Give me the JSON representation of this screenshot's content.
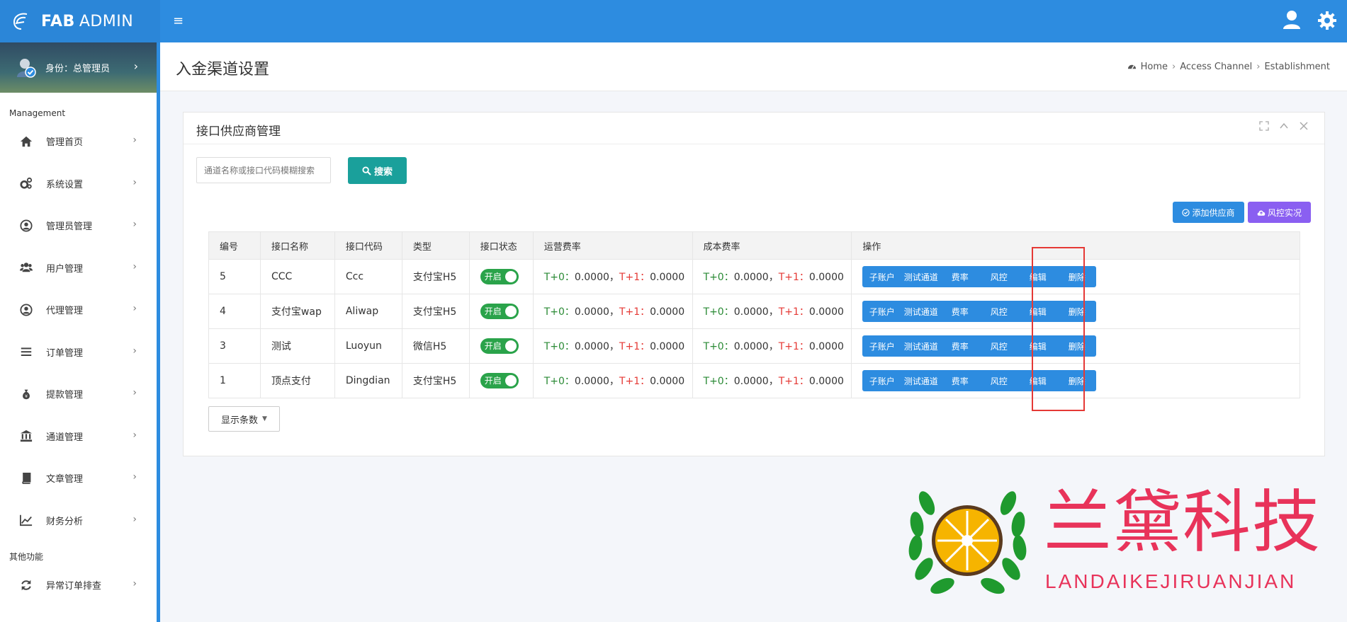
{
  "brand": {
    "bold": "FAB",
    "rest": "ADMIN"
  },
  "identity": {
    "label": "身份：总管理员"
  },
  "sidebar": {
    "section_management": "Management",
    "items": [
      {
        "label": "管理首页",
        "icon": "home-icon"
      },
      {
        "label": "系统设置",
        "icon": "gears-icon"
      },
      {
        "label": "管理员管理",
        "icon": "user-circle-icon"
      },
      {
        "label": "用户管理",
        "icon": "users-icon"
      },
      {
        "label": "代理管理",
        "icon": "user-circle-icon"
      },
      {
        "label": "订单管理",
        "icon": "list-icon"
      },
      {
        "label": "提款管理",
        "icon": "money-bag-icon"
      },
      {
        "label": "通道管理",
        "icon": "bank-icon"
      },
      {
        "label": "文章管理",
        "icon": "book-icon"
      },
      {
        "label": "财务分析",
        "icon": "chart-line-icon"
      }
    ],
    "section_other": "其他功能",
    "other_items": [
      {
        "label": "异常订单排查",
        "icon": "refresh-icon"
      }
    ]
  },
  "page": {
    "title": "入金渠道设置",
    "breadcrumb": [
      "Home",
      "Access Channel",
      "Establishment"
    ]
  },
  "panel": {
    "title": "接口供应商管理",
    "search_placeholder": "通道名称或接口代码模糊搜索",
    "search_button": "搜索",
    "add_button": "添加供应商",
    "risk_button": "风控实况",
    "page_size_label": "显示条数"
  },
  "table": {
    "headers": [
      "编号",
      "接口名称",
      "接口代码",
      "类型",
      "接口状态",
      "运营费率",
      "成本费率",
      "操作"
    ],
    "rows": [
      {
        "id": "5",
        "name": "CCC",
        "code": "Ccc",
        "type": "支付宝H5",
        "status": "开启"
      },
      {
        "id": "4",
        "name": "支付宝wap",
        "code": "Aliwap",
        "type": "支付宝H5",
        "status": "开启"
      },
      {
        "id": "3",
        "name": "测试",
        "code": "Luoyun",
        "type": "微信H5",
        "status": "开启"
      },
      {
        "id": "1",
        "name": "顶点支付",
        "code": "Dingdian",
        "type": "支付宝H5",
        "status": "开启"
      }
    ],
    "rate": {
      "t0_label": "T+0：",
      "t0_value": "0.0000，",
      "t1_label": "T+1：",
      "t1_value": "0.0000"
    },
    "ops": [
      "子账户",
      "测试通道",
      "费率",
      "风控",
      "编辑",
      "删除"
    ]
  },
  "watermark": {
    "cn": "兰黛科技",
    "en": "LANDAIKEJIRUANJIAN"
  },
  "colors": {
    "primary": "#2d8ce0",
    "teal": "#1aa09b",
    "purple": "#8a5ff1",
    "green": "#2aa34a",
    "red": "#e53935"
  }
}
